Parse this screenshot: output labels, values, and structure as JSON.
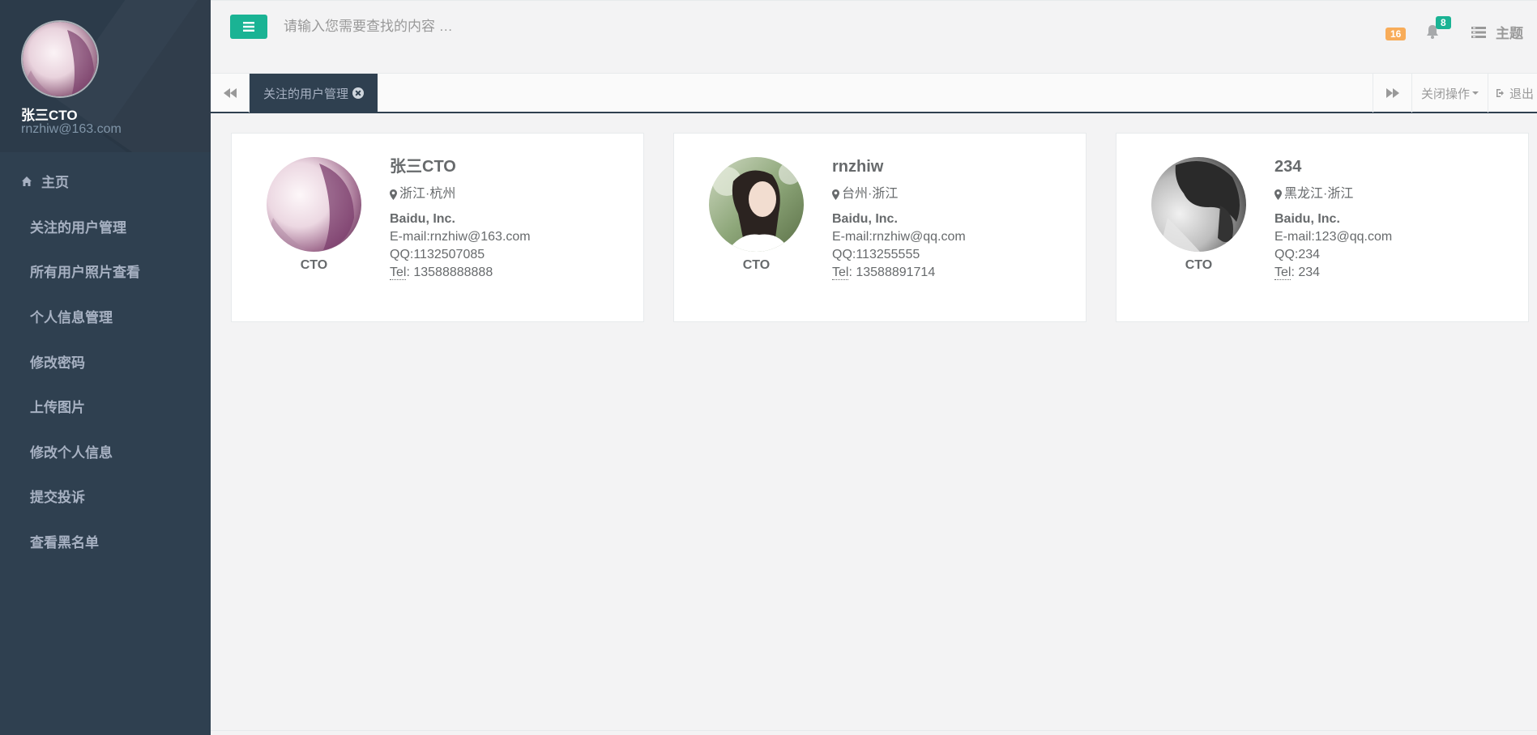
{
  "sidebar": {
    "profile": {
      "name": "张三CTO",
      "email": "rnzhiw@163.com"
    },
    "items": [
      {
        "label": "主页",
        "icon": "home-icon"
      },
      {
        "label": "关注的用户管理"
      },
      {
        "label": "所有用户照片查看"
      },
      {
        "label": "个人信息管理"
      },
      {
        "label": "修改密码"
      },
      {
        "label": "上传图片"
      },
      {
        "label": "修改个人信息"
      },
      {
        "label": "提交投诉"
      },
      {
        "label": "查看黑名单"
      }
    ]
  },
  "topbar": {
    "search_placeholder": "请输入您需要查找的内容 …",
    "messages_count": "16",
    "notifications_count": "8",
    "theme_label": "主题"
  },
  "tabs": {
    "active_label": "关注的用户管理",
    "ops_label": "关闭操作",
    "exit_label": "退出"
  },
  "cards": [
    {
      "name": "张三CTO",
      "location": "浙江·杭州",
      "role": "CTO",
      "company": "Baidu, Inc.",
      "email": "E-mail:rnzhiw@163.com",
      "qq": "QQ:1132507085",
      "tel_label": "Tel",
      "tel_value": ": 13588888888"
    },
    {
      "name": "rnzhiw",
      "location": "台州·浙江",
      "role": "CTO",
      "company": "Baidu, Inc.",
      "email": "E-mail:rnzhiw@qq.com",
      "qq": "QQ:113255555",
      "tel_label": "Tel",
      "tel_value": ": 13588891714"
    },
    {
      "name": "234",
      "location": "黑龙江·浙江",
      "role": "CTO",
      "company": "Baidu, Inc.",
      "email": "E-mail:123@qq.com",
      "qq": "QQ:234",
      "tel_label": "Tel",
      "tel_value": ": 234"
    }
  ],
  "colors": {
    "sidebar_bg": "#2f4050",
    "accent_green": "#1ab394",
    "badge_orange": "#f8ac59",
    "content_bg": "#f3f3f4"
  }
}
